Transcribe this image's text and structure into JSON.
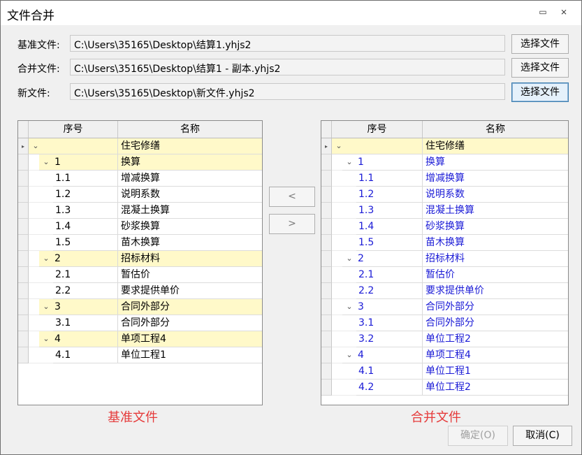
{
  "window": {
    "title": "文件合并",
    "minimize_glyph": "▭",
    "close_glyph": "⨯"
  },
  "files": {
    "base_label": "基准文件:",
    "base_path": "C:\\Users\\35165\\Desktop\\结算1.yhjs2",
    "merge_label": "合并文件:",
    "merge_path": "C:\\Users\\35165\\Desktop\\结算1 - 副本.yhjs2",
    "new_label": "新文件:",
    "new_path": "C:\\Users\\35165\\Desktop\\新文件.yhjs2",
    "choose_label": "选择文件"
  },
  "columns": {
    "seq": "序号",
    "name": "名称"
  },
  "left_tree": [
    {
      "level": 0,
      "seq": "",
      "name": "住宅修缮",
      "group": true,
      "toggle": "⌄",
      "current": true
    },
    {
      "level": 1,
      "seq": "1",
      "name": "换算",
      "group": true,
      "toggle": "⌄"
    },
    {
      "level": 2,
      "seq": "1.1",
      "name": "增减换算"
    },
    {
      "level": 2,
      "seq": "1.2",
      "name": "说明系数"
    },
    {
      "level": 2,
      "seq": "1.3",
      "name": "混凝土换算"
    },
    {
      "level": 2,
      "seq": "1.4",
      "name": "砂浆换算"
    },
    {
      "level": 2,
      "seq": "1.5",
      "name": "苗木换算"
    },
    {
      "level": 1,
      "seq": "2",
      "name": "招标材料",
      "group": true,
      "toggle": "⌄"
    },
    {
      "level": 2,
      "seq": "2.1",
      "name": "暂估价"
    },
    {
      "level": 2,
      "seq": "2.2",
      "name": "要求提供单价"
    },
    {
      "level": 1,
      "seq": "3",
      "name": "合同外部分",
      "group": true,
      "toggle": "⌄"
    },
    {
      "level": 2,
      "seq": "3.1",
      "name": "合同外部分"
    },
    {
      "level": 1,
      "seq": "4",
      "name": "单项工程4",
      "group": true,
      "toggle": "⌄"
    },
    {
      "level": 2,
      "seq": "4.1",
      "name": "单位工程1"
    }
  ],
  "right_tree": [
    {
      "level": 0,
      "seq": "",
      "name": "住宅修缮",
      "group": true,
      "toggle": "⌄",
      "current": true
    },
    {
      "level": 1,
      "seq": "1",
      "name": "换算",
      "blue": true,
      "toggle": "⌄"
    },
    {
      "level": 2,
      "seq": "1.1",
      "name": "增减换算",
      "blue": true
    },
    {
      "level": 2,
      "seq": "1.2",
      "name": "说明系数",
      "blue": true
    },
    {
      "level": 2,
      "seq": "1.3",
      "name": "混凝土换算",
      "blue": true
    },
    {
      "level": 2,
      "seq": "1.4",
      "name": "砂浆换算",
      "blue": true
    },
    {
      "level": 2,
      "seq": "1.5",
      "name": "苗木换算",
      "blue": true
    },
    {
      "level": 1,
      "seq": "2",
      "name": "招标材料",
      "blue": true,
      "toggle": "⌄"
    },
    {
      "level": 2,
      "seq": "2.1",
      "name": "暂估价",
      "blue": true
    },
    {
      "level": 2,
      "seq": "2.2",
      "name": "要求提供单价",
      "blue": true
    },
    {
      "level": 1,
      "seq": "3",
      "name": "合同外部分",
      "blue": true,
      "toggle": "⌄"
    },
    {
      "level": 2,
      "seq": "3.1",
      "name": "合同外部分",
      "blue": true
    },
    {
      "level": 2,
      "seq": "3.2",
      "name": "单位工程2",
      "blue": true
    },
    {
      "level": 1,
      "seq": "4",
      "name": "单项工程4",
      "blue": true,
      "toggle": "⌄"
    },
    {
      "level": 2,
      "seq": "4.1",
      "name": "单位工程1",
      "blue": true
    },
    {
      "level": 2,
      "seq": "4.2",
      "name": "单位工程2",
      "blue": true
    }
  ],
  "row_pointer_glyph": "▸",
  "move_left_label": "<",
  "move_right_label": ">",
  "left_caption": "基准文件",
  "right_caption": "合并文件",
  "ok_label": "确定(O)",
  "cancel_label": "取消(C)"
}
